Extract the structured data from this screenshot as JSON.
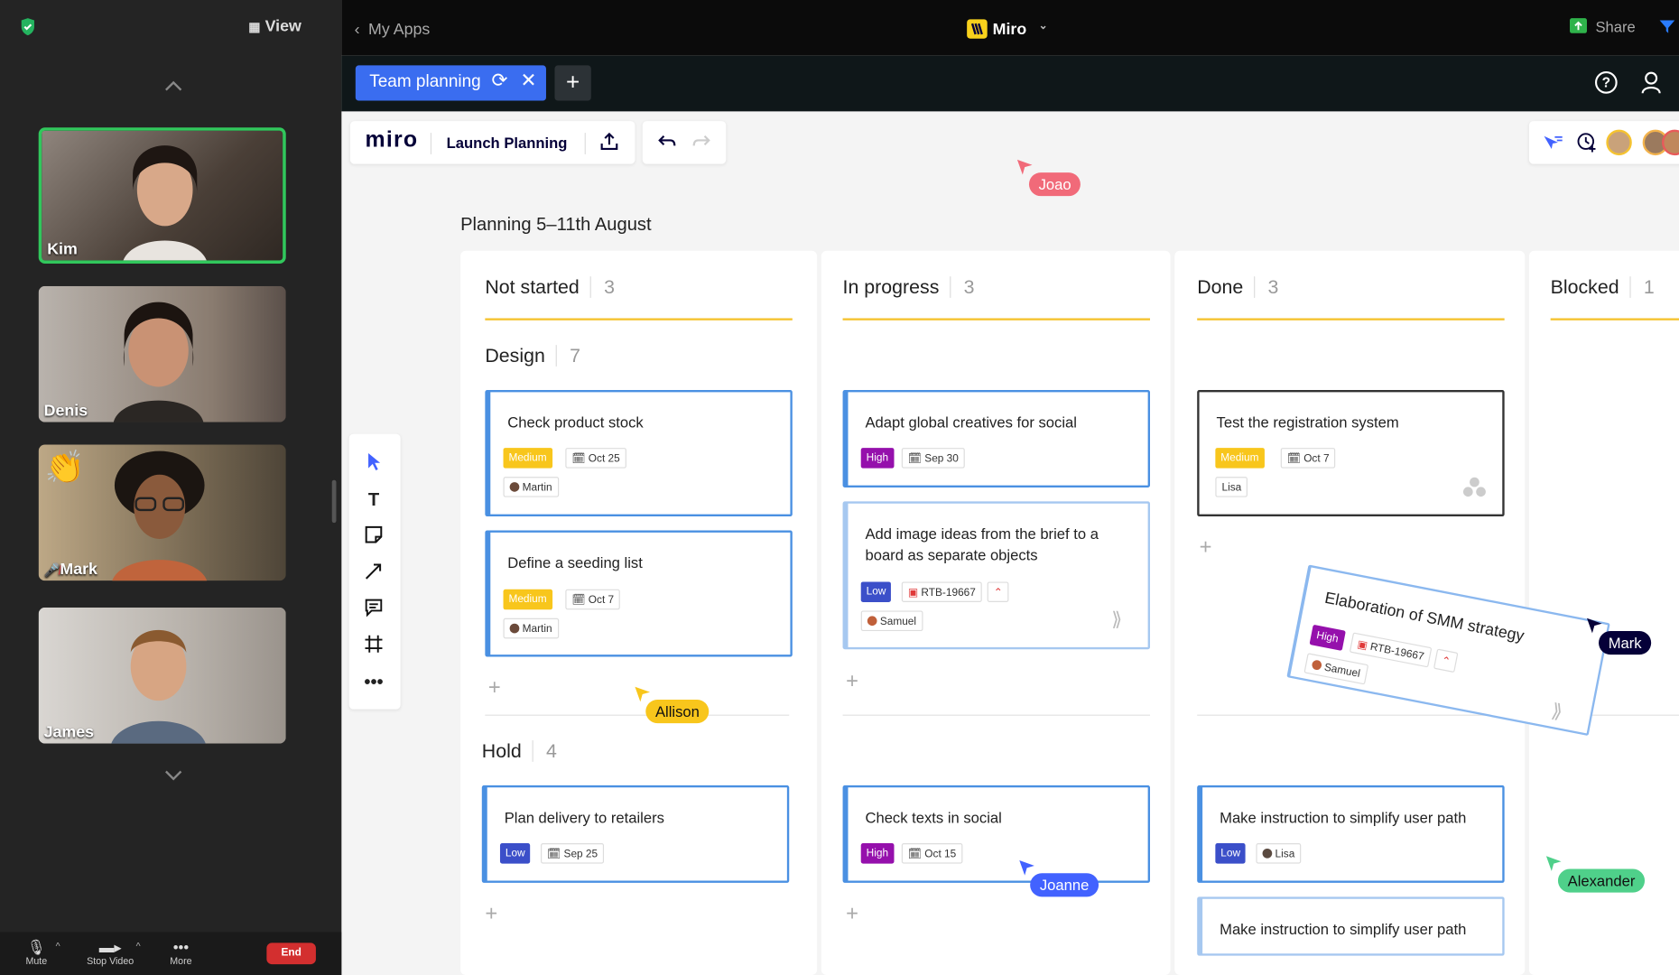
{
  "zoom": {
    "view_label": "View",
    "participants": [
      {
        "name": "Kim",
        "bg": "#6e6258"
      },
      {
        "name": "Denis",
        "bg": "#7a6d63"
      },
      {
        "name": "Mark",
        "bg": "#8b7a62"
      },
      {
        "name": "James",
        "bg": "#8d8a85"
      }
    ],
    "toolbar": {
      "mute": "Mute",
      "video": "Stop Video",
      "more": "More",
      "end": "End"
    }
  },
  "header": {
    "back": "My Apps",
    "app": "Miro",
    "share": "Share"
  },
  "tab": {
    "label": "Team planning"
  },
  "board": {
    "logo": "miro",
    "name": "Launch Planning",
    "title": "Planning 5–11th August",
    "columns": [
      {
        "title": "Not started",
        "count": "3"
      },
      {
        "title": "In progress",
        "count": "3"
      },
      {
        "title": "Done",
        "count": "3"
      },
      {
        "title": "Blocked",
        "count": "1"
      }
    ],
    "groups": {
      "design": {
        "title": "Design",
        "count": "7"
      },
      "hold": {
        "title": "Hold",
        "count": "4"
      }
    },
    "cards": {
      "c1": {
        "title": "Check product stock",
        "priority": "Medium",
        "date": "Oct 25",
        "owner": "Martin"
      },
      "c2": {
        "title": "Define a seeding list",
        "priority": "Medium",
        "date": "Oct 7",
        "owner": "Martin"
      },
      "c3": {
        "title": "Adapt global creatives for social",
        "priority": "High",
        "date": "Sep 30"
      },
      "c4": {
        "title": "Add image ideas from the brief to a board as separate objects",
        "priority": "Low",
        "ticket": "RTB-19667",
        "owner": "Samuel"
      },
      "c5": {
        "title": "Test the registration system",
        "priority": "Medium",
        "date": "Oct 7",
        "owner": "Lisa"
      },
      "c6": {
        "title": "Elaboration of SMM strategy",
        "priority": "High",
        "ticket": "RTB-19667",
        "owner": "Samuel"
      },
      "c7": {
        "title": "Plan delivery to retailers",
        "priority": "Low",
        "date": "Sep 25"
      },
      "c8": {
        "title": "Check texts in social",
        "priority": "High",
        "date": "Oct 15"
      },
      "c9": {
        "title": "Make instruction to simplify user path",
        "priority": "Low",
        "owner": "Lisa"
      },
      "c10": {
        "title": "Make instruction to simplify user path"
      }
    },
    "cursors": {
      "joao": "Joao",
      "allison": "Allison",
      "mark": "Mark",
      "joanne": "Joanne",
      "alexander": "Alexander"
    }
  },
  "colors": {
    "medium": "#f8c61c",
    "high": "#9510ac",
    "low": "#3b4fc9",
    "accent": "#4262ff",
    "card_border": "#4a90e2"
  }
}
